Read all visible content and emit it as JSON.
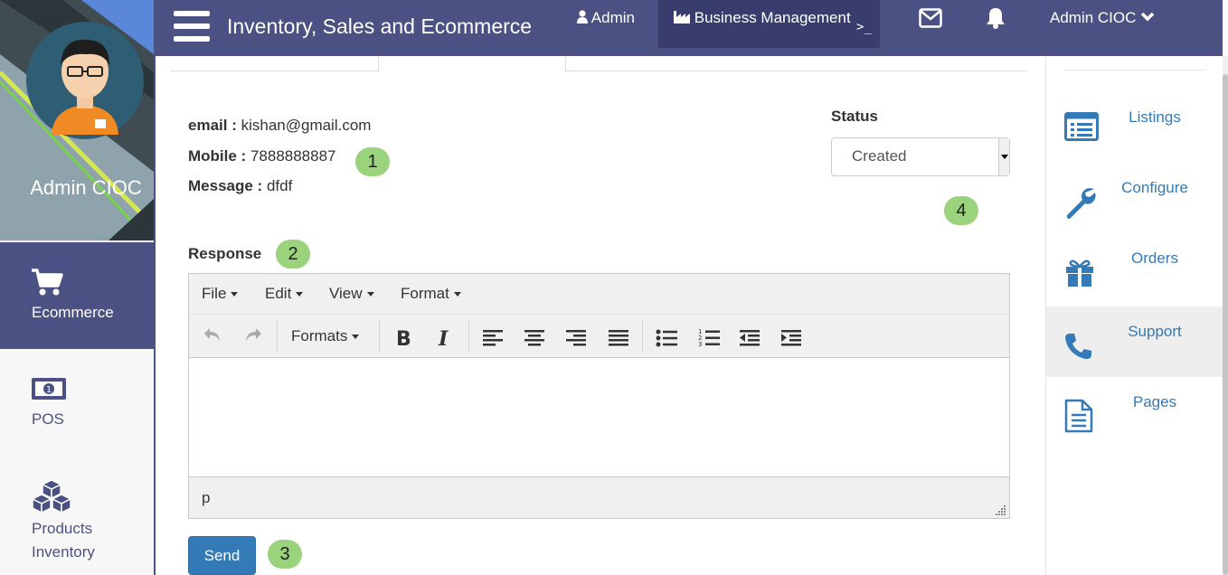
{
  "topbar": {
    "title": "Inventory, Sales and Ecommerce",
    "admin_link": "Admin",
    "business_link": "Business Management",
    "business_cursor": ">_",
    "user_menu": "Admin CIOC"
  },
  "profile": {
    "name": "Admin CIOC"
  },
  "sidebar": {
    "items": [
      {
        "label": "Ecommerce",
        "icon": "cart-icon",
        "active": true
      },
      {
        "label": "POS",
        "icon": "money-icon"
      },
      {
        "label": "Products Inventory",
        "icon": "cubes-icon"
      }
    ]
  },
  "right_nav": {
    "items": [
      {
        "label": "Listings",
        "icon": "list-icon"
      },
      {
        "label": "Configure",
        "icon": "wrench-icon"
      },
      {
        "label": "Orders",
        "icon": "gift-icon"
      },
      {
        "label": "Support",
        "icon": "phone-icon",
        "active": true
      },
      {
        "label": "Pages",
        "icon": "file-text-icon"
      }
    ]
  },
  "ticket": {
    "email_label": "email :",
    "email": "kishan@gmail.com",
    "mobile_label": "Mobile :",
    "mobile": "7888888887",
    "message_label": "Message :",
    "message": "dfdf"
  },
  "status": {
    "label": "Status",
    "selected": "Created"
  },
  "response": {
    "label": "Response"
  },
  "editor": {
    "menus": [
      "File",
      "Edit",
      "View",
      "Format"
    ],
    "formats_label": "Formats",
    "status_path": "p",
    "content": ""
  },
  "send_label": "Send",
  "badges": [
    "1",
    "2",
    "3",
    "4"
  ],
  "colors": {
    "brand": "#4b5182",
    "brand_dark": "#383d6e",
    "link": "#337ab7",
    "badge": "#9bd27c"
  }
}
